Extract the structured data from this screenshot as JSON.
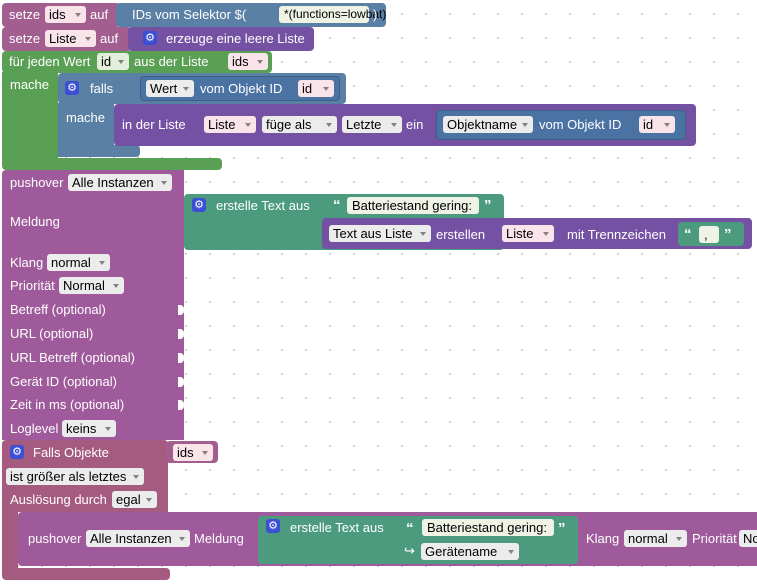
{
  "colors": {
    "var": "#a25e8f",
    "list": "#7451a3",
    "loop": "#5aa054",
    "logic": "#5b80a5",
    "text": "#4c9b7f",
    "push": "#9e5a9a",
    "trigger": "#a55b80"
  },
  "row1": {
    "set": "setze",
    "var": "ids",
    "to": "auf",
    "label": "IDs vom Selektor $(",
    "selector": "*(functions=lowbat)",
    "close": ")"
  },
  "row2": {
    "set": "setze",
    "var": "Liste",
    "to": "auf",
    "label": "erzeuge eine leere Liste",
    "icon": "gear-icon"
  },
  "loop": {
    "label": "für jeden Wert",
    "var": "id",
    "from": "aus der Liste",
    "list": "ids",
    "do": "mache"
  },
  "ifblock": {
    "if": "falls",
    "do": "mache",
    "wert": "Wert",
    "vom_objekt": "vom Objekt ID",
    "id": "id",
    "icon": "gear-icon"
  },
  "insert": {
    "in_list": "in der Liste",
    "list": "Liste",
    "add_as": "füge als",
    "position": "Letzte",
    "at": "ein",
    "name": "Objektname",
    "vom_objekt": "vom Objekt ID",
    "id": "id"
  },
  "pushover": {
    "title": "pushover",
    "instance": "Alle Instanzen",
    "message_label": "Meldung",
    "create_text": "erstelle Text aus",
    "text1": "Batteriestand gering:",
    "text_from_list": "Text aus Liste",
    "create": "erstellen",
    "list": "Liste",
    "sep_label": "mit Trennzeichen",
    "sep": ",",
    "fields": [
      {
        "label": "Klang",
        "value": "normal"
      },
      {
        "label": "Priorität",
        "value": "Normal"
      },
      {
        "label": "Betreff (optional)",
        "value": ""
      },
      {
        "label": "URL (optional)",
        "value": ""
      },
      {
        "label": "URL Betreff (optional)",
        "value": ""
      },
      {
        "label": "Gerät ID (optional)",
        "value": ""
      },
      {
        "label": "Zeit in ms (optional)",
        "value": ""
      },
      {
        "label": "Loglevel",
        "value": "keins"
      }
    ]
  },
  "trigger": {
    "label": "Falls Objekte",
    "ids": "ids",
    "condition": "ist größer als letztes",
    "trigger_label": "Auslösung durch",
    "trigger_value": "egal",
    "icon": "gear-icon"
  },
  "pushover2": {
    "title": "pushover",
    "instance": "Alle Instanzen",
    "message_label": "Meldung",
    "create_text": "erstelle Text aus",
    "text1": "Batteriestand gering:",
    "geraetename": "Gerätename",
    "klang_label": "Klang",
    "klang": "normal",
    "prio_label": "Priorität",
    "prio": "No"
  }
}
